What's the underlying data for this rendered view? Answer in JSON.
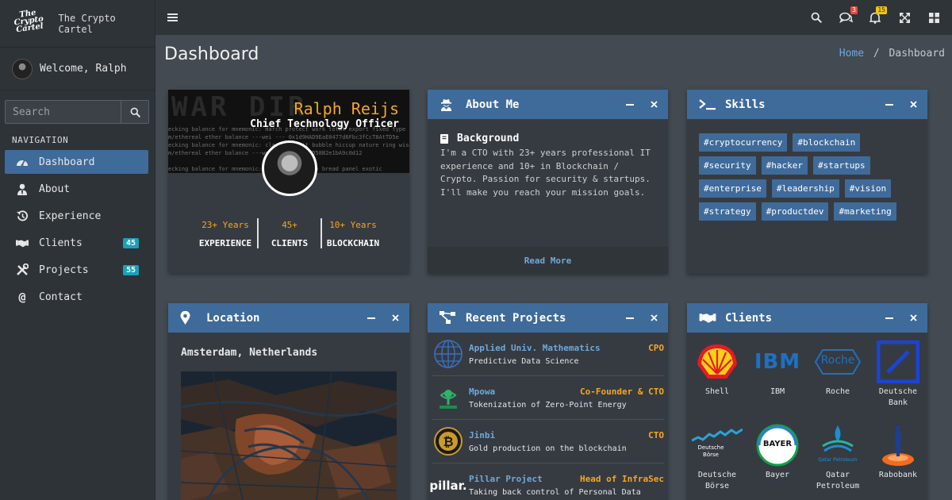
{
  "brand": {
    "logo_text": "The Crypto Cartel",
    "name": "The Crypto Cartel"
  },
  "user": {
    "welcome": "Welcome, Ralph"
  },
  "search": {
    "placeholder": "Search"
  },
  "nav": {
    "title": "NAVIGATION",
    "items": [
      {
        "label": "Dashboard",
        "icon": "dashboard-icon",
        "active": true
      },
      {
        "label": "About",
        "icon": "user-tie-icon"
      },
      {
        "label": "Experience",
        "icon": "history-icon"
      },
      {
        "label": "Clients",
        "icon": "handshake-icon",
        "badge": "45"
      },
      {
        "label": "Projects",
        "icon": "tools-icon",
        "badge": "55"
      },
      {
        "label": "Contact",
        "icon": "at-icon"
      }
    ]
  },
  "topbar": {
    "icons": [
      "search-icon",
      "comments-icon",
      "bell-icon",
      "expand-icon",
      "grid-icon"
    ],
    "messages_badge": "3",
    "notifications_badge": "15",
    "badge_colors": {
      "messages": "#e74c3c",
      "notifications": "#f1c40f"
    }
  },
  "page": {
    "title": "Dashboard",
    "breadcrumb_home": "Home",
    "breadcrumb_sep": "/",
    "breadcrumb_current": "Dashboard"
  },
  "profile": {
    "name": "Ralph Reijs",
    "role": "Chief Technology Officer",
    "stats": [
      {
        "value": "23+ Years",
        "label": "EXPERIENCE"
      },
      {
        "value": "45+",
        "label": "CLIENTS"
      },
      {
        "value": "10+ Years",
        "label": "BLOCKCHAIN"
      }
    ]
  },
  "about": {
    "title": "About Me",
    "subtitle": "Background",
    "text": "I'm a CTO with 23+ years professional IT experience and 10+ in Blockchain / Crypto. Passion for security & startups. I'll make you reach your mission goals.",
    "read_more": "Read More"
  },
  "skills": {
    "title": "Skills",
    "tags": [
      "#cryptocurrency",
      "#blockchain",
      "#security",
      "#hacker",
      "#startups",
      "#enterprise",
      "#leadership",
      "#vision",
      "#strategy",
      "#productdev",
      "#marketing"
    ]
  },
  "location": {
    "title": "Location",
    "place": "Amsterdam, Netherlands"
  },
  "projects": {
    "title": "Recent Projects",
    "items": [
      {
        "name": "Applied Univ. Mathematics",
        "role": "CPO",
        "desc": "Predictive Data Science",
        "logo": "globe-logo"
      },
      {
        "name": "Mpowa",
        "role": "Co-Founder & CTO",
        "desc": "Tokenization of Zero-Point Energy",
        "logo": "mpowa-logo"
      },
      {
        "name": "Jinbi",
        "role": "CTO",
        "desc": "Gold production on the blockchain",
        "logo": "jinbi-logo"
      },
      {
        "name": "Pillar Project",
        "role": "Head of InfraSec",
        "desc": "Taking back control of Personal Data",
        "logo": "pillar-logo",
        "logo_text": "pillar."
      }
    ]
  },
  "clients": {
    "title": "Clients",
    "items": [
      {
        "name": "Shell",
        "logo": "shell-logo"
      },
      {
        "name": "IBM",
        "logo": "ibm-logo",
        "logo_text": "IBM"
      },
      {
        "name": "Roche",
        "logo": "roche-logo",
        "logo_text": "Roche"
      },
      {
        "name": "Deutsche Bank",
        "logo": "deutsche-bank-logo"
      },
      {
        "name": "Deutsche Börse",
        "logo": "deutsche-borse-logo",
        "logo_text": "Deutsche Börse"
      },
      {
        "name": "Bayer",
        "logo": "bayer-logo",
        "logo_text": "BAYER"
      },
      {
        "name": "Qatar Petroleum",
        "logo": "qatar-petroleum-logo",
        "logo_text": "Qatar Petroleum"
      },
      {
        "name": "Rabobank",
        "logo": "rabobank-logo"
      }
    ]
  },
  "colors": {
    "accent": "#3f6b9b",
    "orange": "#f5a623",
    "link": "#6fa8dc",
    "badge_teal": "#1aa1b8"
  }
}
